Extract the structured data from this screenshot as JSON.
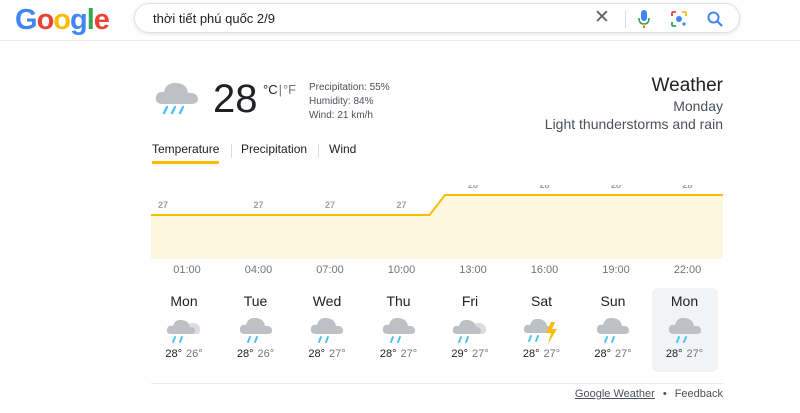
{
  "logo": {
    "letters": [
      "G",
      "o",
      "o",
      "g",
      "l",
      "e"
    ],
    "colors": [
      "#4285F4",
      "#EA4335",
      "#FBBC05",
      "#4285F4",
      "#34A853",
      "#EA4335"
    ]
  },
  "search": {
    "query": "thời tiết phú quốc 2/9",
    "clear_symbol": "✕"
  },
  "current": {
    "temp": "28",
    "unit_c": "°C",
    "unit_sep": "|",
    "unit_f": "°F",
    "precipitation": "Precipitation: 55%",
    "humidity": "Humidity: 84%",
    "wind": "Wind: 21 km/h",
    "title": "Weather",
    "day": "Monday",
    "condition": "Light thunderstorms and rain"
  },
  "tabs": [
    {
      "label": "Temperature",
      "active": true
    },
    {
      "label": "Precipitation",
      "active": false
    },
    {
      "label": "Wind",
      "active": false
    }
  ],
  "chart_data": {
    "type": "area",
    "x": [
      "01:00",
      "04:00",
      "07:00",
      "10:00",
      "13:00",
      "16:00",
      "19:00",
      "22:00"
    ],
    "values": [
      27,
      27,
      27,
      27,
      28,
      28,
      28,
      28
    ],
    "color": "#fbbc04",
    "fill": "#fef7e0"
  },
  "days": [
    {
      "name": "Mon",
      "high": "28°",
      "low": "26°",
      "icon": "cloud-sun-rain-icon",
      "selected": false
    },
    {
      "name": "Tue",
      "high": "28°",
      "low": "26°",
      "icon": "cloud-rain-icon",
      "selected": false
    },
    {
      "name": "Wed",
      "high": "28°",
      "low": "27°",
      "icon": "cloud-rain-icon",
      "selected": false
    },
    {
      "name": "Thu",
      "high": "28°",
      "low": "27°",
      "icon": "cloud-rain-icon",
      "selected": false
    },
    {
      "name": "Fri",
      "high": "29°",
      "low": "27°",
      "icon": "cloud-sun-rain-icon",
      "selected": false
    },
    {
      "name": "Sat",
      "high": "28°",
      "low": "27°",
      "icon": "thunderstorm-icon",
      "selected": false
    },
    {
      "name": "Sun",
      "high": "28°",
      "low": "27°",
      "icon": "cloud-rain-icon",
      "selected": false
    },
    {
      "name": "Mon",
      "high": "28°",
      "low": "27°",
      "icon": "cloud-rain-icon",
      "selected": true
    }
  ],
  "footer": {
    "source": "Google Weather",
    "dot": "•",
    "feedback": "Feedback"
  }
}
